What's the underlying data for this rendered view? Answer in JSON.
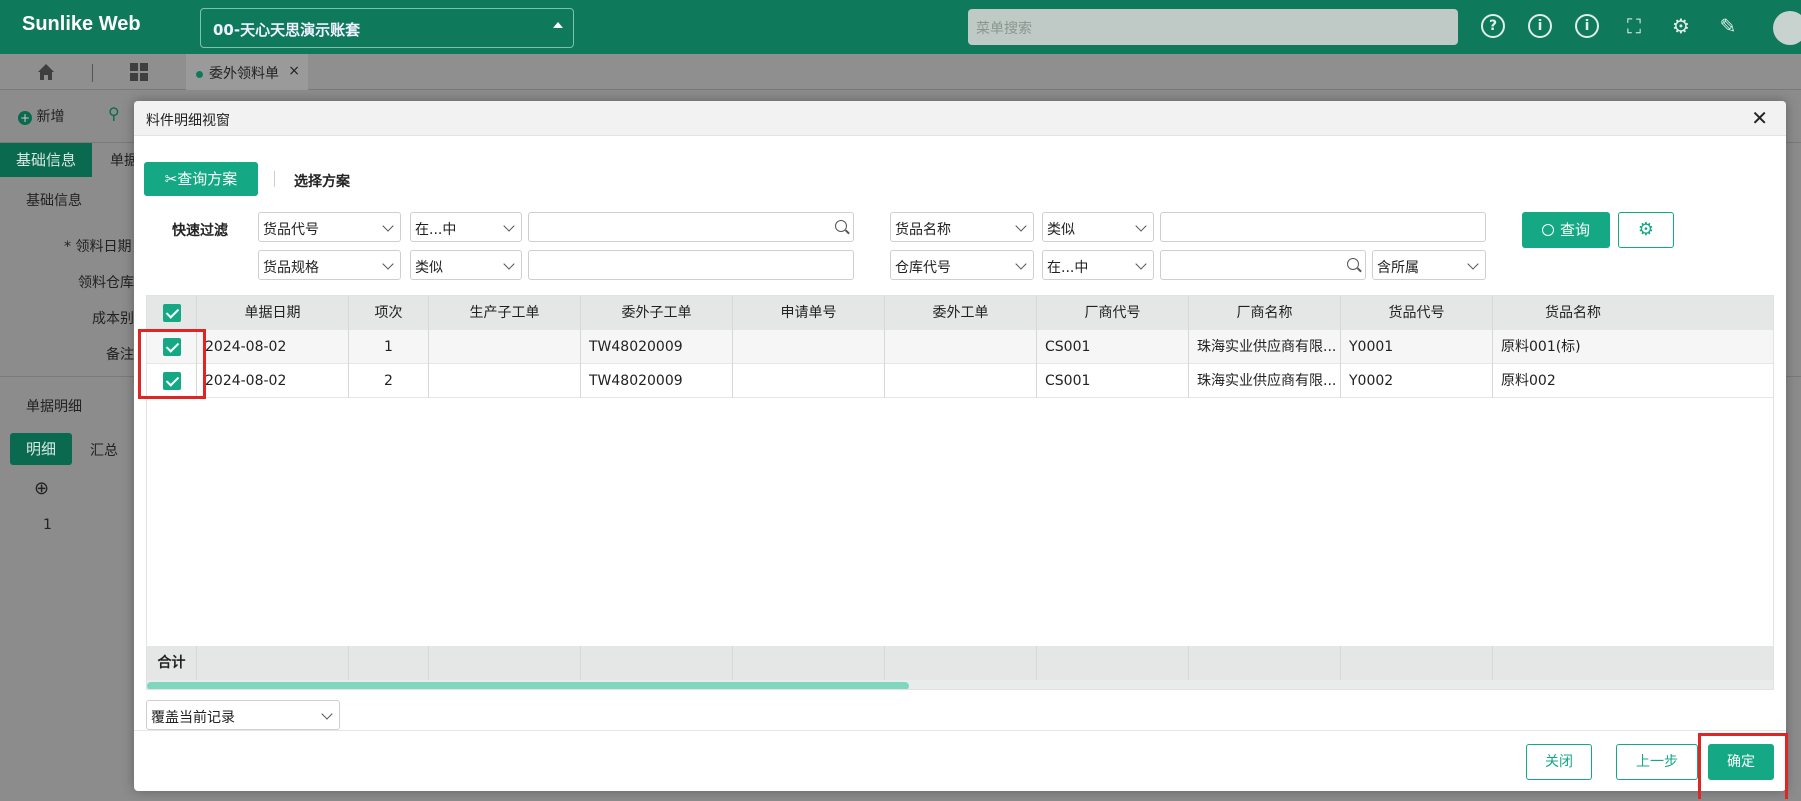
{
  "app": {
    "logo": "Sunlike Web",
    "account": "00-天心天思演示账套",
    "menu_search_placeholder": "菜单搜索"
  },
  "tabs": {
    "open_doc": "委外领料单"
  },
  "background": {
    "new_label": "新增",
    "tab_basic": "基础信息",
    "tab_doc_prefix": "单据",
    "section_basic": "基础信息",
    "field_date": "* 领料日期",
    "field_warehouse": "领料仓库",
    "field_cost": "成本别",
    "field_note": "备注",
    "section_detail": "单据明细",
    "subtab_detail": "明细",
    "subtab_summary": "汇总",
    "row_no": "1"
  },
  "modal": {
    "title": "料件明细视窗",
    "query_plan_btn": "查询方案",
    "select_plan": "选择方案",
    "quick_filter": "快速过滤",
    "filters": {
      "f1_field": "货品代号",
      "f1_op": "在...中",
      "f2_field": "货品名称",
      "f2_op": "类似",
      "f3_field": "货品规格",
      "f3_op": "类似",
      "f4_field": "仓库代号",
      "f4_op": "在...中",
      "f4_scope": "含所属"
    },
    "query_btn": "查询",
    "columns": [
      "单据日期",
      "项次",
      "生产子工单",
      "委外子工单",
      "申请单号",
      "委外工单",
      "厂商代号",
      "厂商名称",
      "货品代号",
      "货品名称"
    ],
    "rows": [
      {
        "date": "2024-08-02",
        "seq": "1",
        "prod_order": "",
        "sub_order": "TW48020009",
        "apply_no": "",
        "out_order": "",
        "vendor_code": "CS001",
        "vendor_name": "珠海实业供应商有限...",
        "item_code": "Y0001",
        "item_name": "原料001(标)"
      },
      {
        "date": "2024-08-02",
        "seq": "2",
        "prod_order": "",
        "sub_order": "TW48020009",
        "apply_no": "",
        "out_order": "",
        "vendor_code": "CS001",
        "vendor_name": "珠海实业供应商有限...",
        "item_code": "Y0002",
        "item_name": "原料002"
      }
    ],
    "total_label": "合计",
    "mode_select": "覆盖当前记录",
    "close_btn": "关闭",
    "prev_btn": "上一步",
    "confirm_btn": "确定"
  },
  "colors": {
    "brand": "#0f7a5b",
    "accent": "#15a884",
    "highlight": "#e02525"
  }
}
